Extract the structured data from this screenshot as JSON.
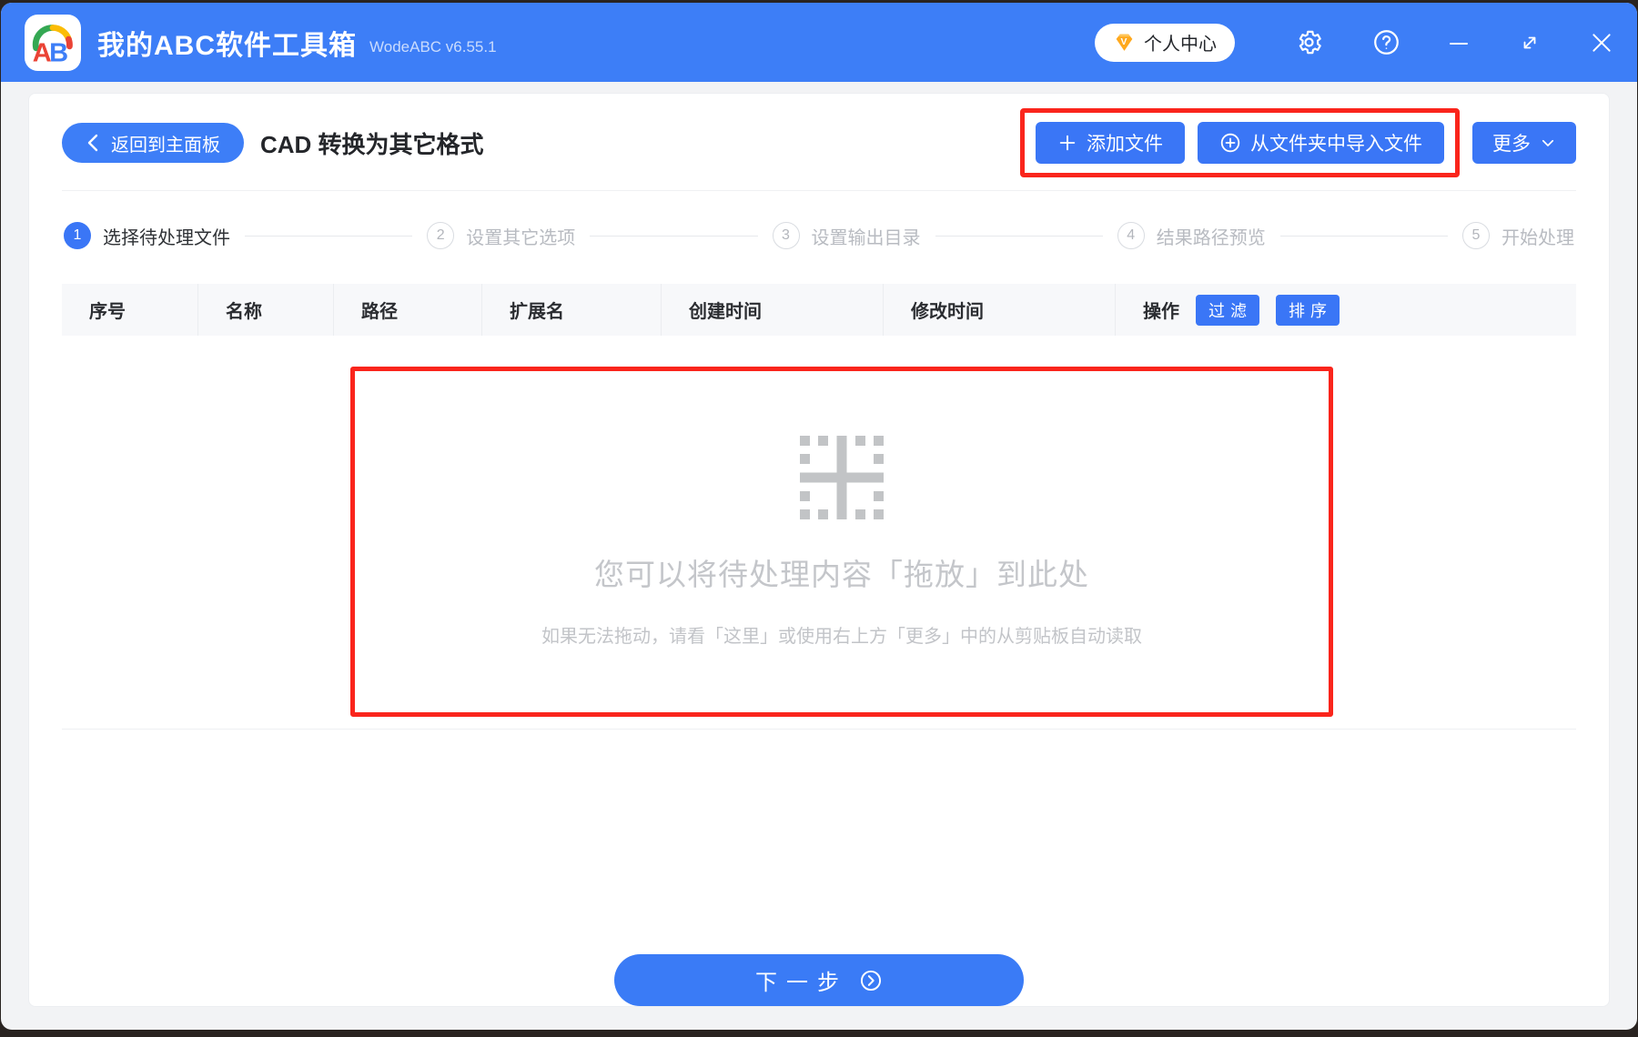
{
  "window": {
    "app_title": "我的ABC软件工具箱",
    "app_version": "WodeABC v6.55.1",
    "account_center": "个人中心"
  },
  "toolbar": {
    "back": "返回到主面板",
    "page_title": "CAD 转换为其它格式",
    "add_files": "添加文件",
    "import_from_folder": "从文件夹中导入文件",
    "more": "更多"
  },
  "steps": [
    {
      "num": "1",
      "label": "选择待处理文件"
    },
    {
      "num": "2",
      "label": "设置其它选项"
    },
    {
      "num": "3",
      "label": "设置输出目录"
    },
    {
      "num": "4",
      "label": "结果路径预览"
    },
    {
      "num": "5",
      "label": "开始处理"
    }
  ],
  "table": {
    "headers": {
      "index": "序号",
      "name": "名称",
      "path": "路径",
      "ext": "扩展名",
      "created": "创建时间",
      "modified": "修改时间",
      "actions": "操作"
    },
    "filter": "过滤",
    "sort": "排序",
    "rows": []
  },
  "dropzone": {
    "title": "您可以将待处理内容「拖放」到此处",
    "hint": "如果无法拖动，请看「这里」或使用右上方「更多」中的从剪贴板自动读取"
  },
  "footer": {
    "next": "下一步"
  },
  "colors": {
    "header_blue": "#3d7ef7",
    "accent": "#3a76f6",
    "highlight_red": "#fa251c"
  }
}
